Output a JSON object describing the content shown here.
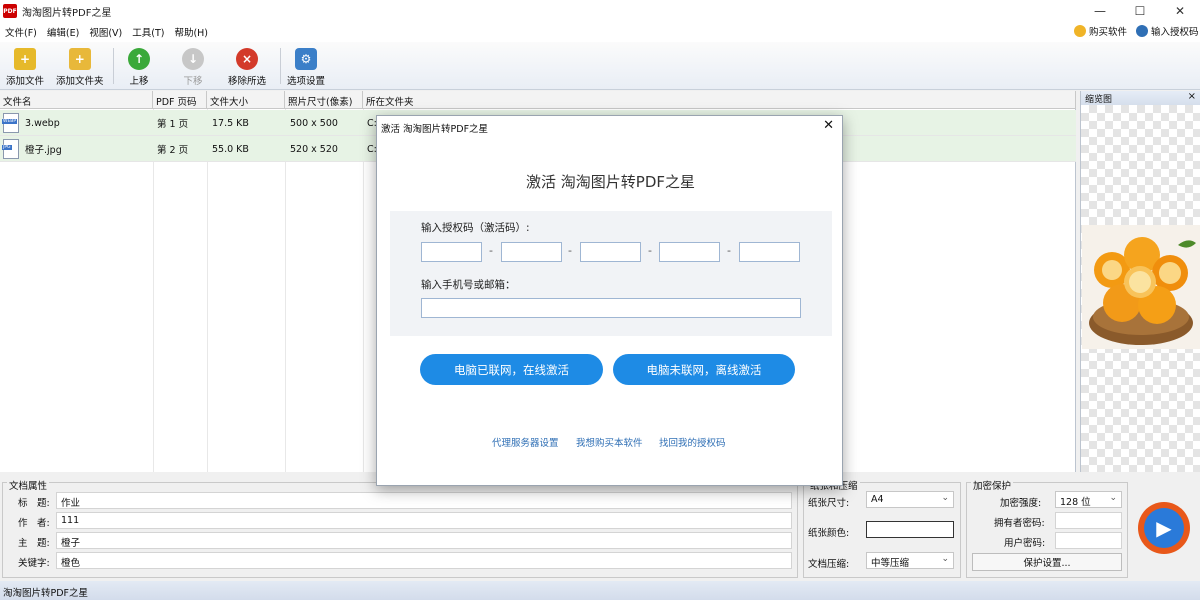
{
  "window": {
    "title": "淘淘图片转PDF之星",
    "app_icon_text": "PDF",
    "min": "—",
    "max": "☐",
    "close": "✕"
  },
  "menu": {
    "items": [
      "文件(F)",
      "编辑(E)",
      "视图(V)",
      "工具(T)",
      "帮助(H)"
    ],
    "buy": "购买软件",
    "enter_license": "输入授权码"
  },
  "toolbar": {
    "add_file": "添加文件",
    "add_folder": "添加文件夹",
    "move_up": "上移",
    "move_down": "下移",
    "remove_selected": "移除所选",
    "options": "选项设置"
  },
  "table": {
    "headers": [
      "文件名",
      "PDF 页码",
      "文件大小",
      "照片尺寸(像素)",
      "所在文件夹"
    ],
    "rows": [
      {
        "name": "3.webp",
        "type": "WEBP",
        "page": "第 1 页",
        "size": "17.5 KB",
        "dims": "500 x 500",
        "folder": "C:"
      },
      {
        "name": "橙子.jpg",
        "type": "JPG",
        "page": "第 2 页",
        "size": "55.0 KB",
        "dims": "520 x 520",
        "folder": "C:"
      }
    ]
  },
  "thumbnail": {
    "title": "缩览图",
    "close": "×"
  },
  "doc_props": {
    "title": "文档属性",
    "title_label": "标　题:",
    "title_value": "作业",
    "author_label": "作　者:",
    "author_value": "111",
    "subject_label": "主　题:",
    "subject_value": "橙子",
    "keywords_label": "关键字:",
    "keywords_value": "橙色"
  },
  "paper": {
    "title": "纸张和压缩",
    "size_label": "纸张尺寸:",
    "size_value": "A4",
    "color_label": "纸张颜色:",
    "compress_label": "文档压缩:",
    "compress_value": "中等压缩"
  },
  "encrypt": {
    "title": "加密保护",
    "strength_label": "加密强度:",
    "strength_value": "128 位",
    "owner_label": "拥有者密码:",
    "user_label": "用户密码:",
    "settings_button": "保护设置..."
  },
  "statusbar": {
    "text": "淘淘图片转PDF之星"
  },
  "dialog": {
    "title": "激活 淘淘图片转PDF之星",
    "close": "✕",
    "heading": "激活 淘淘图片转PDF之星",
    "license_label": "输入授权码（激活码）:",
    "dash": "-",
    "contact_label": "输入手机号或邮箱：",
    "online_button": "电脑已联网，在线激活",
    "offline_button": "电脑未联网，离线激活",
    "proxy_link": "代理服务器设置",
    "buy_link": "我想购买本软件",
    "recover_link": "找回我的授权码"
  },
  "colors": {
    "accent": "#1e8be5",
    "selected_row": "#e7f3e5",
    "link": "#2f6fb5"
  }
}
